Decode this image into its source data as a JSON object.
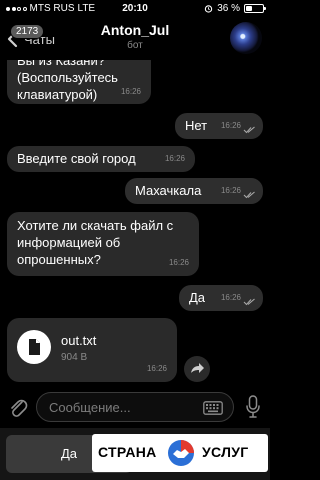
{
  "status_bar": {
    "carrier": "MTS RUS",
    "network": "LTE",
    "time": "20:10",
    "battery_percent": "36 %",
    "battery_level": 0.36
  },
  "nav": {
    "back_label": "Чаты",
    "unread_badge": "2173",
    "title": "Anton_Jul",
    "subtitle": "бот",
    "avatar_icon": "avatar-icon"
  },
  "messages": [
    {
      "direction": "in",
      "text": "Вы из Казани? (Воспользуйтесь клавиатурой)",
      "time": "16:26"
    },
    {
      "direction": "out",
      "text": "Нет",
      "time": "16:26",
      "read": true
    },
    {
      "direction": "in",
      "text": "Введите свой город",
      "time": "16:26"
    },
    {
      "direction": "out",
      "text": "Махачкала",
      "time": "16:26",
      "read": true
    },
    {
      "direction": "in",
      "text": "Хотите ли скачать файл с информацией об опрошенных?",
      "time": "16:26"
    },
    {
      "direction": "out",
      "text": "Да",
      "time": "16:26",
      "read": true
    },
    {
      "direction": "in",
      "type": "file",
      "file_name": "out.txt",
      "file_size": "904 B",
      "time": "16:26"
    }
  ],
  "composer": {
    "placeholder": "Сообщение...",
    "attach_icon": "paperclip-icon",
    "keyboard_icon": "keyboard-icon",
    "mic_icon": "microphone-icon"
  },
  "reply_keyboard": {
    "buttons": [
      "Да"
    ]
  },
  "watermark": {
    "left_text": "СТРАНА",
    "right_text": "УСЛУГ"
  },
  "colors": {
    "bubble_in": "#2a2a2a",
    "bubble_out": "#2e2e2e",
    "background": "#000000"
  }
}
